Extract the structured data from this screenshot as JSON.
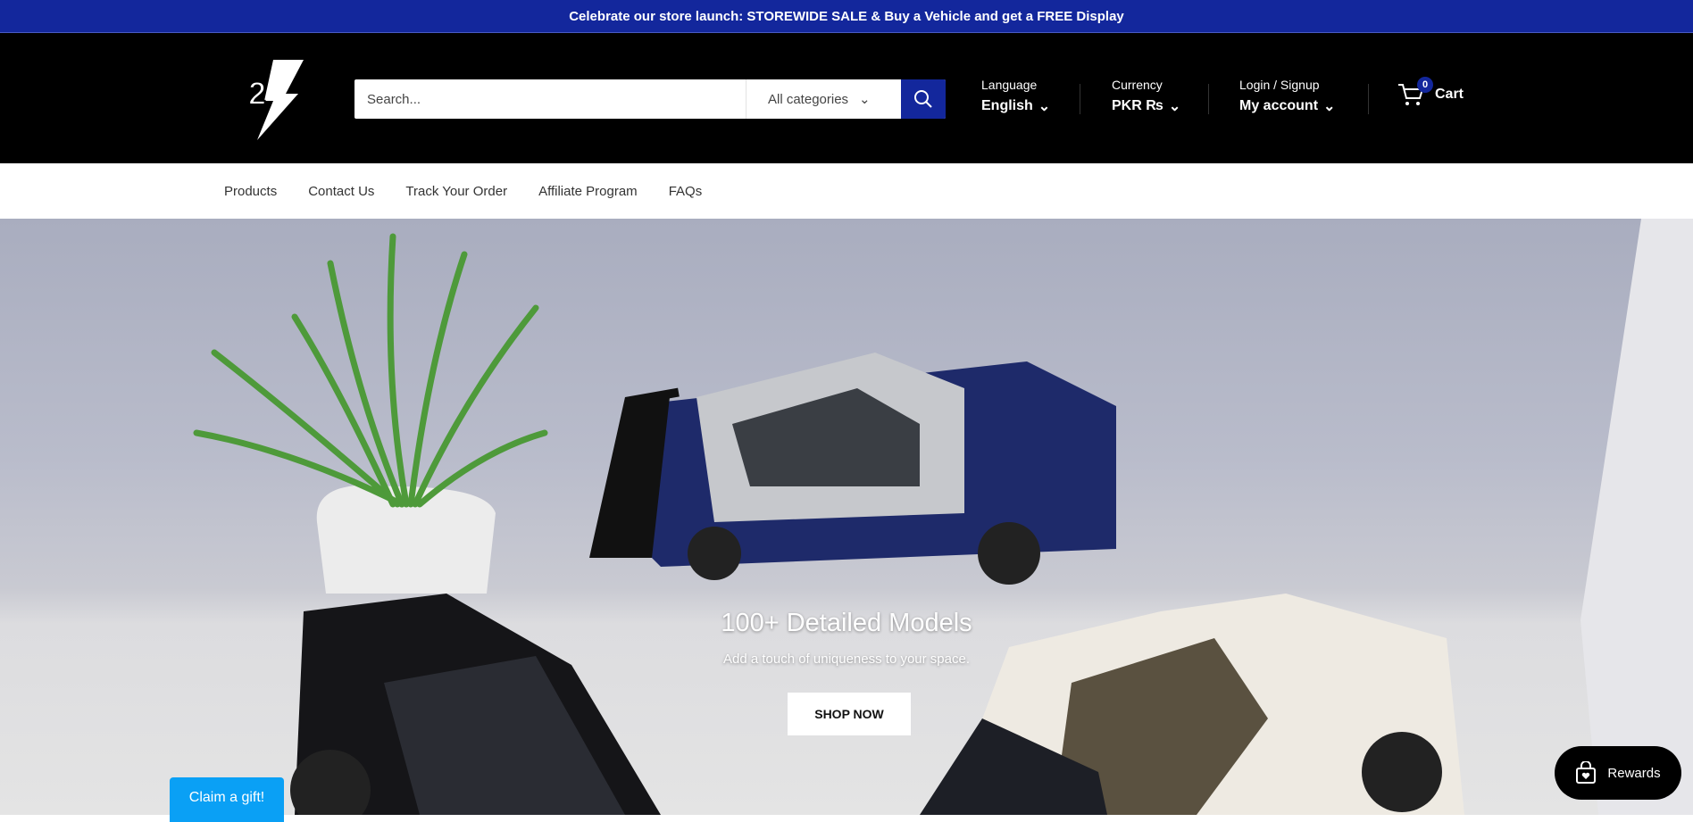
{
  "announcement": "Celebrate our store launch: STOREWIDE SALE & Buy a Vehicle and get a FREE Display",
  "logo": {
    "text": "2"
  },
  "search": {
    "placeholder": "Search...",
    "category": "All categories"
  },
  "language": {
    "label": "Language",
    "value": "English"
  },
  "currency": {
    "label": "Currency",
    "value": "PKR ₨"
  },
  "account": {
    "label": "Login / Signup",
    "value": "My account"
  },
  "cart": {
    "label": "Cart",
    "count": "0"
  },
  "nav": [
    "Products",
    "Contact Us",
    "Track Your Order",
    "Affiliate Program",
    "FAQs"
  ],
  "hero": {
    "title": "100+ Detailed Models",
    "subtitle": "Add a touch of uniqueness to your space.",
    "button": "SHOP NOW"
  },
  "claim_gift": "Claim a gift!",
  "rewards": "Rewards",
  "colors": {
    "brand": "#13279c",
    "claim": "#0aa0f5"
  }
}
